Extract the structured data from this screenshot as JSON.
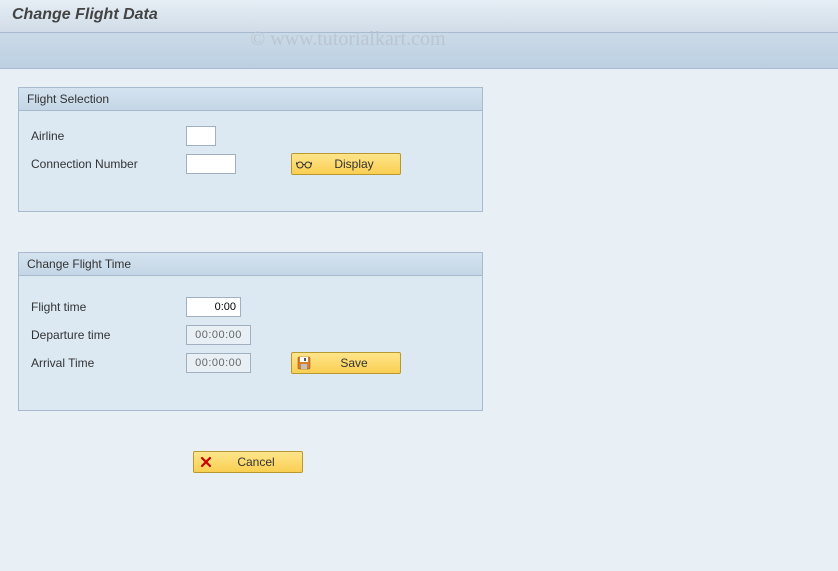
{
  "page": {
    "title": "Change Flight Data"
  },
  "watermark": "© www.tutorialkart.com",
  "groups": {
    "selection": {
      "title": "Flight Selection",
      "airline_label": "Airline",
      "airline_value": "",
      "connection_label": "Connection Number",
      "connection_value": "",
      "display_button": "Display"
    },
    "change_time": {
      "title": "Change Flight Time",
      "flight_time_label": "Flight time",
      "flight_time_value": "0:00",
      "departure_label": "Departure time",
      "departure_value": "00:00:00",
      "arrival_label": "Arrival Time",
      "arrival_value": "00:00:00",
      "save_button": "Save"
    }
  },
  "cancel_button": "Cancel"
}
